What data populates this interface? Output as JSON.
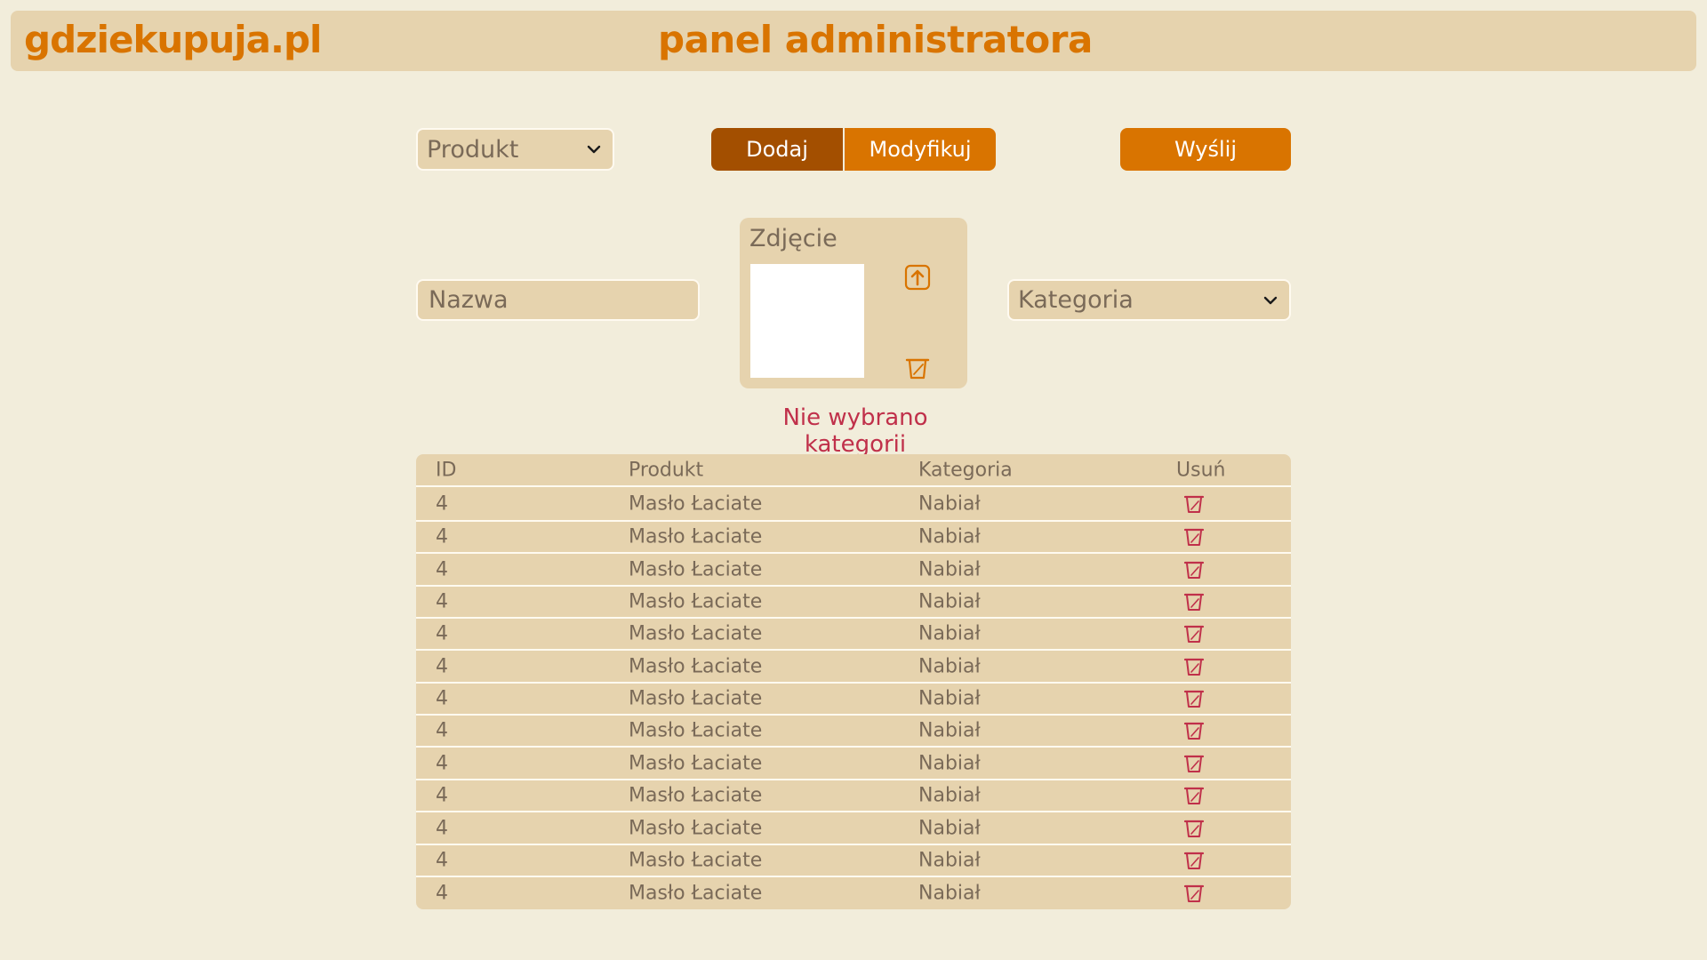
{
  "header": {
    "logo": "gdziekupuja.pl",
    "title": "panel administratora"
  },
  "toolbar": {
    "type_select": "Produkt",
    "add_label": "Dodaj",
    "modify_label": "Modyfikuj",
    "send_label": "Wyślij"
  },
  "form": {
    "name_placeholder": "Nazwa",
    "photo_label": "Zdjęcie",
    "category_select": "Kategoria",
    "error": "Nie wybrano kategorii"
  },
  "table": {
    "headers": [
      "ID",
      "Produkt",
      "Kategoria",
      "Usuń"
    ],
    "rows": [
      {
        "id": "4",
        "product": "Masło Łaciate",
        "category": "Nabiał"
      },
      {
        "id": "4",
        "product": "Masło Łaciate",
        "category": "Nabiał"
      },
      {
        "id": "4",
        "product": "Masło Łaciate",
        "category": "Nabiał"
      },
      {
        "id": "4",
        "product": "Masło Łaciate",
        "category": "Nabiał"
      },
      {
        "id": "4",
        "product": "Masło Łaciate",
        "category": "Nabiał"
      },
      {
        "id": "4",
        "product": "Masło Łaciate",
        "category": "Nabiał"
      },
      {
        "id": "4",
        "product": "Masło Łaciate",
        "category": "Nabiał"
      },
      {
        "id": "4",
        "product": "Masło Łaciate",
        "category": "Nabiał"
      },
      {
        "id": "4",
        "product": "Masło Łaciate",
        "category": "Nabiał"
      },
      {
        "id": "4",
        "product": "Masło Łaciate",
        "category": "Nabiał"
      },
      {
        "id": "4",
        "product": "Masło Łaciate",
        "category": "Nabiał"
      },
      {
        "id": "4",
        "product": "Masło Łaciate",
        "category": "Nabiał"
      },
      {
        "id": "4",
        "product": "Masło Łaciate",
        "category": "Nabiał"
      }
    ]
  },
  "icons": {
    "dropdown": "chevron-down-icon",
    "upload": "upload-icon",
    "delete": "trash-icon"
  },
  "colors": {
    "background": "#f2eddb",
    "panel": "#e6d3ae",
    "accent": "#d97400",
    "accent_dark": "#a34f00",
    "error": "#c0304a",
    "text": "#7a6a58"
  }
}
